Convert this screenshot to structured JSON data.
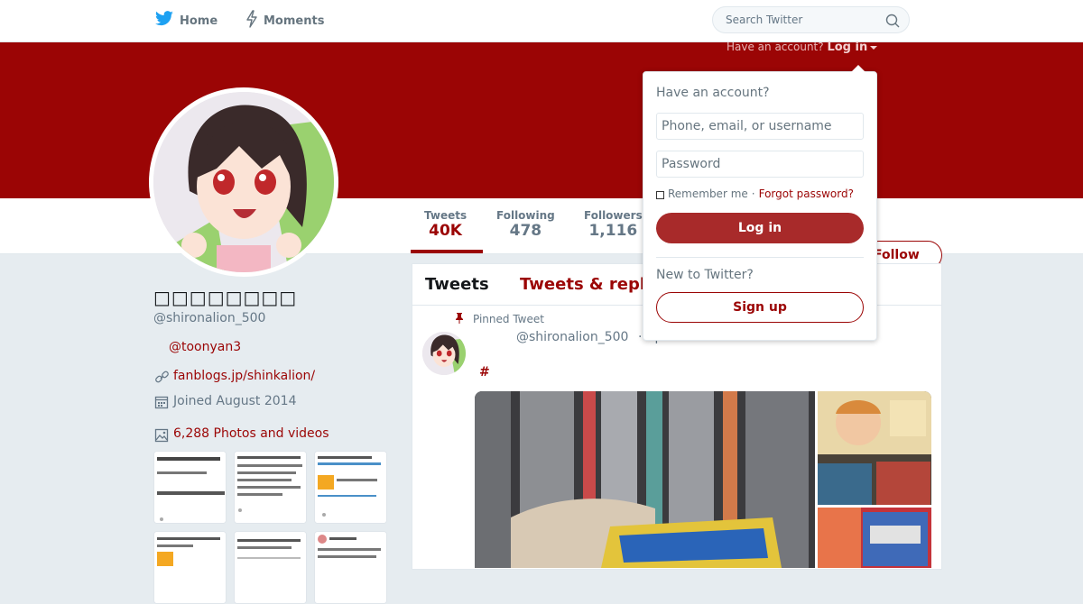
{
  "nav": {
    "home_label": "Home",
    "moments_label": "Moments",
    "search_placeholder": "Search Twitter",
    "brand_color": "#1da1f2"
  },
  "login_hint": {
    "text": "Have an account?",
    "link": "Log in"
  },
  "profile": {
    "name": "□□□□□□□□",
    "handle": "@shironalion_500",
    "mention": "@toonyan3",
    "website": "fanblogs.jp/shinkalion/",
    "joined": "Joined August 2014",
    "photos_label": "6,288 Photos and videos",
    "theme_color": "#9b0505"
  },
  "stats": [
    {
      "label": "Tweets",
      "value": "40K"
    },
    {
      "label": "Following",
      "value": "478"
    },
    {
      "label": "Followers",
      "value": "1,116"
    }
  ],
  "follow_label": "Follow",
  "timeline": {
    "tab_tweets": "Tweets",
    "tab_replies": "Tweets & replies",
    "pinned_label": "Pinned Tweet",
    "tweet_handle": "@shironalion_500",
    "tweet_date": "· Apr 17",
    "hashtag": "#"
  },
  "login_dropdown": {
    "title": "Have an account?",
    "username_placeholder": "Phone, email, or username",
    "password_placeholder": "Password",
    "remember": "Remember me",
    "separator": "·",
    "forgot": "Forgot password?",
    "login_button": "Log in",
    "new_label": "New to Twitter?",
    "signup_button": "Sign up"
  },
  "icons": [
    "twitter-bird-icon",
    "lightning-icon",
    "search-icon",
    "link-icon",
    "calendar-icon",
    "photo-icon",
    "pin-icon",
    "caret-down-icon"
  ]
}
